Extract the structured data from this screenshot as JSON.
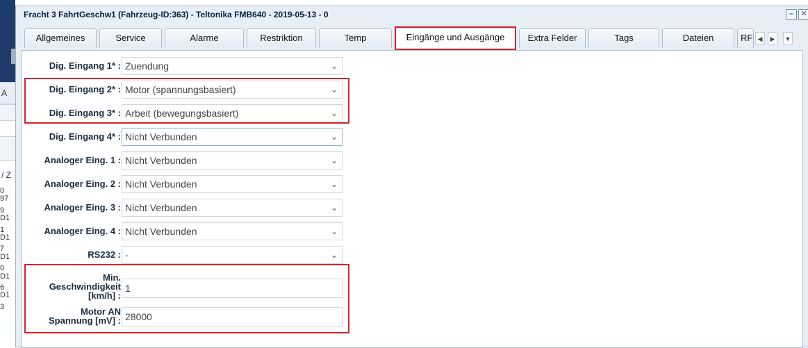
{
  "window": {
    "title": "Fracht 3 FahrtGeschw1 (Fahrzeug-ID:363) - Teltonika FMB640 - 2019-05-13 - 0",
    "minimize_symbol": "–",
    "close_symbol": "✕"
  },
  "background_app": {
    "row_a": "A",
    "row_z": "/ Z",
    "column_fragments": [
      "0",
      "97",
      "9",
      "D1",
      "1",
      "D1",
      "7",
      "D1",
      "0",
      "D1",
      "6",
      "D1",
      "3"
    ]
  },
  "tabs": [
    {
      "label": "Allgemeines"
    },
    {
      "label": "Service"
    },
    {
      "label": "Alarme"
    },
    {
      "label": "Restriktion"
    },
    {
      "label": "Temp"
    },
    {
      "label": "Eingänge und Ausgänge"
    },
    {
      "label": "Extra Felder"
    },
    {
      "label": "Tags"
    },
    {
      "label": "Dateien"
    },
    {
      "label": "RF"
    }
  ],
  "tab_scroll": {
    "left": "◀",
    "right": "▶",
    "menu": "▼"
  },
  "form": {
    "selects": [
      {
        "label": "Dig. Eingang 1* :",
        "value": "Zuendung"
      },
      {
        "label": "Dig. Eingang 2* :",
        "value": "Motor (spannungsbasiert)"
      },
      {
        "label": "Dig. Eingang 3* :",
        "value": "Arbeit (bewegungsbasiert)"
      },
      {
        "label": "Dig. Eingang 4* :",
        "value": "Nicht Verbunden"
      },
      {
        "label": "Analoger Eing. 1 :",
        "value": "Nicht Verbunden"
      },
      {
        "label": "Analoger Eing. 2 :",
        "value": "Nicht Verbunden"
      },
      {
        "label": "Analoger Eing. 3 :",
        "value": "Nicht Verbunden"
      },
      {
        "label": "Analoger Eing. 4 :",
        "value": "Nicht Verbunden"
      },
      {
        "label": "RS232 :",
        "value": "-"
      }
    ],
    "chevron": "⌄",
    "min_speed": {
      "label_lines": [
        "Min.",
        "Geschwindigkeit",
        "[km/h] :"
      ],
      "value": "1"
    },
    "motor_voltage": {
      "label_lines": [
        "Motor AN",
        "Spannung [mV] :"
      ],
      "value": "28000"
    }
  }
}
